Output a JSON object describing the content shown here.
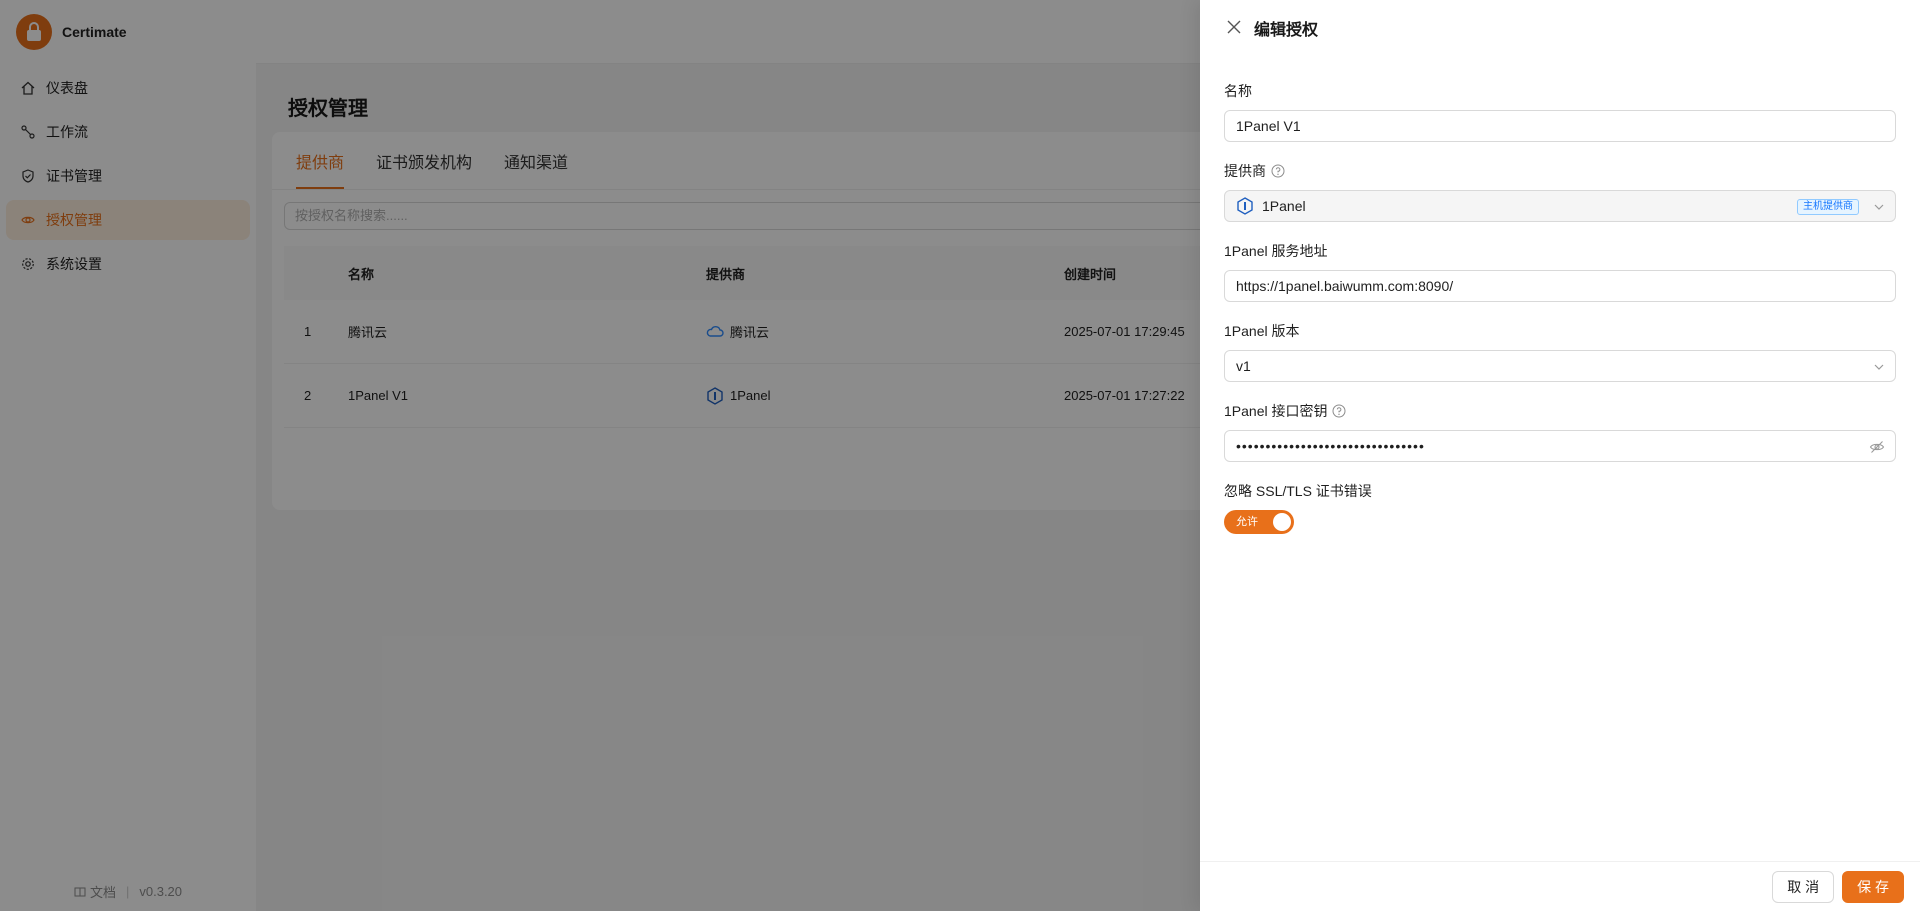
{
  "app": {
    "name": "Certimate",
    "version": "v0.3.20",
    "docs_label": "文档",
    "accent": "#e8701a"
  },
  "sidebar": {
    "items": [
      {
        "label": "仪表盘",
        "icon": "home-icon"
      },
      {
        "label": "工作流",
        "icon": "workflow-icon"
      },
      {
        "label": "证书管理",
        "icon": "shield-check-icon"
      },
      {
        "label": "授权管理",
        "icon": "eye-icon",
        "active": true
      },
      {
        "label": "系统设置",
        "icon": "gear-icon"
      }
    ]
  },
  "page": {
    "title": "授权管理",
    "tabs": [
      "提供商",
      "证书颁发机构",
      "通知渠道"
    ],
    "search_placeholder": "按授权名称搜索......",
    "table": {
      "headers": [
        "名称",
        "提供商",
        "创建时间"
      ],
      "rows": [
        {
          "index": "1",
          "name": "腾讯云",
          "provider": "腾讯云",
          "provider_icon": "tencent-cloud-icon",
          "created": "2025-07-01 17:29:45"
        },
        {
          "index": "2",
          "name": "1Panel V1",
          "provider": "1Panel",
          "provider_icon": "1panel-icon",
          "created": "2025-07-01 17:27:22"
        }
      ]
    }
  },
  "drawer": {
    "title": "编辑授权",
    "fields": {
      "name": {
        "label": "名称",
        "value": "1Panel V1"
      },
      "provider": {
        "label": "提供商",
        "value": "1Panel",
        "tag": "主机提供商"
      },
      "server_url": {
        "label": "1Panel 服务地址",
        "value": "https://1panel.baiwumm.com:8090/"
      },
      "version": {
        "label": "1Panel 版本",
        "value": "v1"
      },
      "api_key": {
        "label": "1Panel 接口密钥",
        "value": "••••••••••••••••••••••••••••••••"
      },
      "ignore_ssl": {
        "label": "忽略 SSL/TLS 证书错误",
        "switch_text": "允许",
        "checked": true
      }
    },
    "cancel_label": "取 消",
    "save_label": "保 存"
  }
}
